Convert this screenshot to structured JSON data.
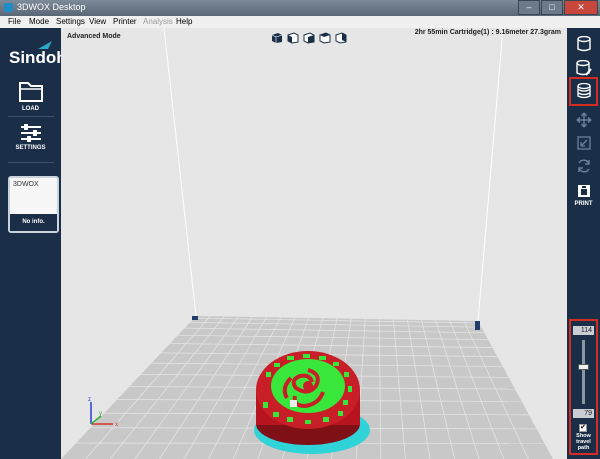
{
  "window": {
    "title": "3DWOX Desktop",
    "controls": [
      "–",
      "□",
      "✕"
    ]
  },
  "menu": [
    {
      "label": "File",
      "enabled": true
    },
    {
      "label": "Mode",
      "enabled": true
    },
    {
      "label": "Settings",
      "enabled": true
    },
    {
      "label": "View",
      "enabled": true
    },
    {
      "label": "Printer",
      "enabled": true
    },
    {
      "label": "Analysis",
      "enabled": false
    },
    {
      "label": "Help",
      "enabled": true
    }
  ],
  "sidebar": {
    "logo": "Sindoh",
    "load_label": "LOAD",
    "settings_label": "SETTINGS",
    "printer": {
      "name": "3DWOX",
      "status": "No info."
    }
  },
  "viewport": {
    "mode": "Advanced Mode",
    "print_info": "2hr 55min  Cartridge(1) : 9.16meter 27.3gram",
    "axes": {
      "x": "x",
      "y": "y",
      "z": "z"
    },
    "colors": {
      "background": "#e6e6e6",
      "bed": "#c8c8c8",
      "model": "#c81e28",
      "infill": "#39e63a",
      "support": "#2fd3d8"
    }
  },
  "toolbar_right": {
    "icons": [
      "model-icon",
      "edit-model-icon",
      "layer-view-icon",
      "move-icon",
      "scale-icon",
      "rotate-icon",
      "print-icon"
    ],
    "print_label": "PRINT",
    "layer_view_highlighted": true
  },
  "layer_slider": {
    "max": "114",
    "min": "79",
    "show_travel_label": "Show travel path",
    "show_travel_checked": true
  }
}
